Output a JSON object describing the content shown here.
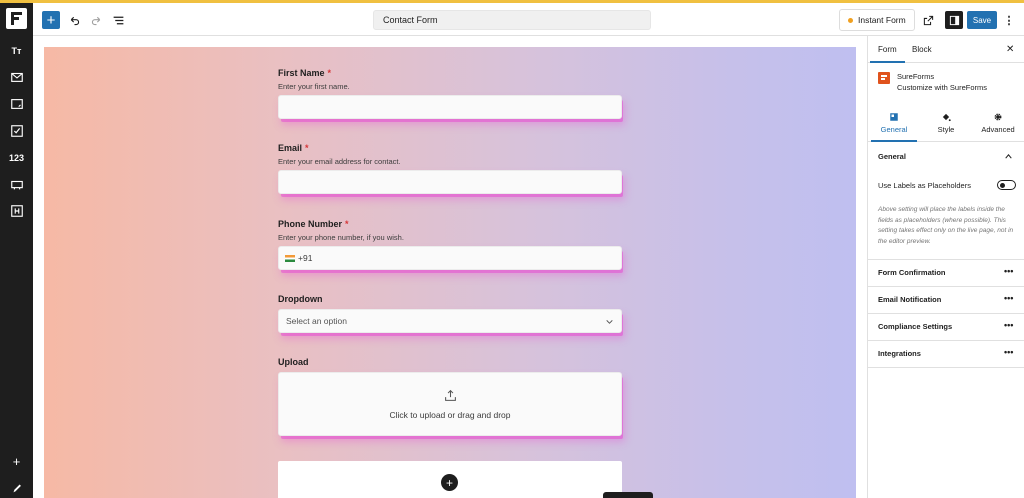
{
  "toolbar": {
    "add_label": "+",
    "doc_title": "Contact Form",
    "instant_form_label": "Instant Form",
    "save_label": "Save",
    "more_label": "⋮"
  },
  "left_bar": {
    "heading_icon_label": "Tт",
    "number_icon_label": "123",
    "add_label": "+"
  },
  "form": {
    "fields": [
      {
        "label": "First Name",
        "required": "*",
        "description": "Enter your first name."
      },
      {
        "label": "Email",
        "required": "*",
        "description": "Enter your email address for contact."
      },
      {
        "label": "Phone Number",
        "required": "*",
        "description": "Enter your phone number, if you wish.",
        "value": "+91"
      },
      {
        "label": "Dropdown",
        "placeholder": "Select an option"
      },
      {
        "label": "Upload",
        "upload_text": "Click to upload or drag and drop"
      }
    ],
    "appender_label": "+"
  },
  "panel": {
    "tabs": [
      "Form",
      "Block"
    ],
    "close_label": "✕",
    "plugin_name": "SureForms",
    "plugin_sub": "Customize with SureForms",
    "sub_tabs": [
      "General",
      "Style",
      "Advanced"
    ],
    "general": {
      "title": "General",
      "toggle_label": "Use Labels as Placeholders",
      "help": "Above setting will place the labels inside the fields as placeholders (where possible). This setting takes effect only on the live page, not in the editor preview."
    },
    "sections": [
      "Form Confirmation",
      "Email Notification",
      "Compliance Settings",
      "Integrations"
    ],
    "dots": "•••"
  },
  "colors": {
    "accent": "#2271b1",
    "dark": "#1e1e1e",
    "required": "#d63638",
    "brand": "#e0531d"
  }
}
